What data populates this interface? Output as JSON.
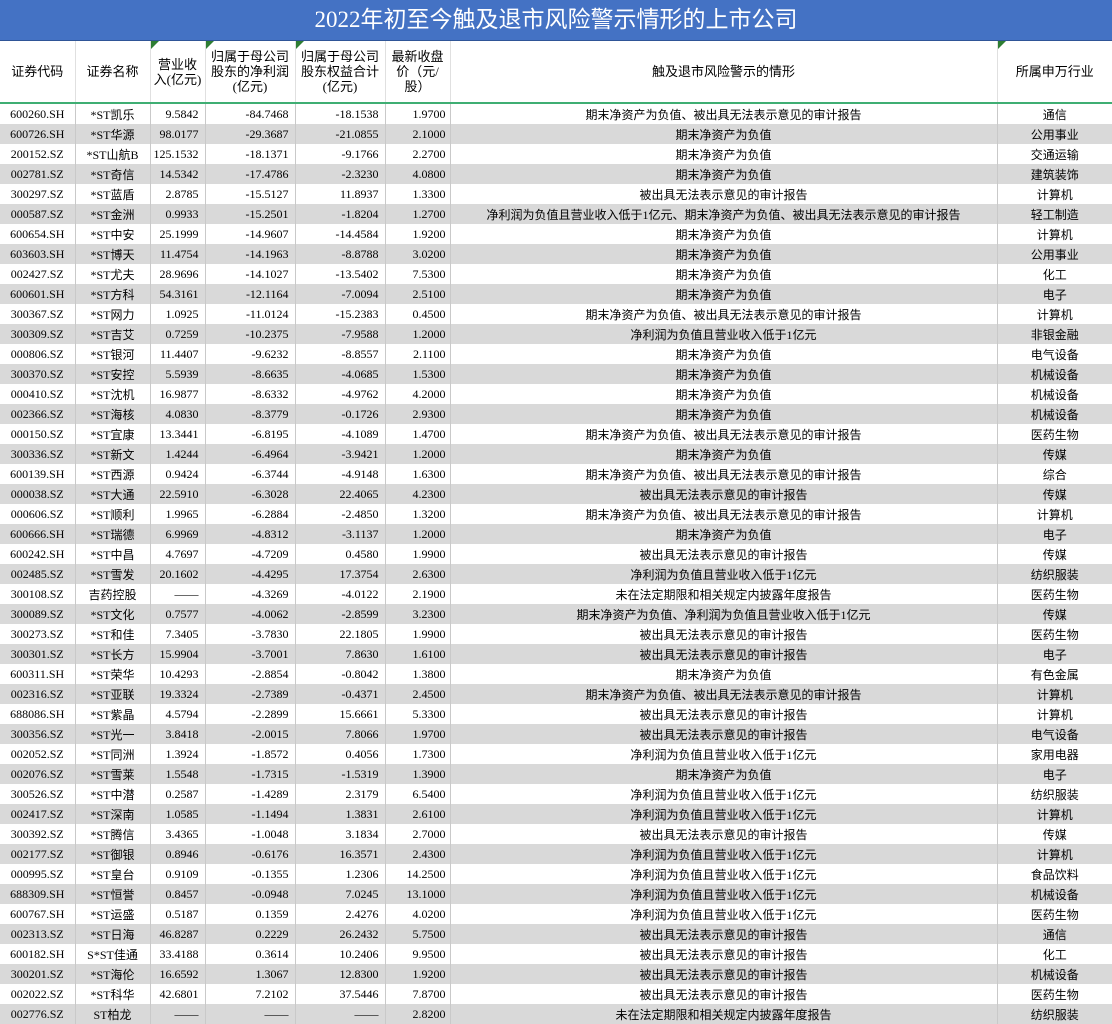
{
  "title": "2022年初至今触及退市风险警示情形的上市公司",
  "headers": {
    "code": "证券代码",
    "name": "证券名称",
    "revenue": "营业收入(亿元)",
    "net_profit": "归属于母公司股东的净利润(亿元)",
    "equity": "归属于母公司股东权益合计(亿元)",
    "close": "最新收盘价（元/股）",
    "situation": "触及退市风险警示的情形",
    "industry": "所属申万行业"
  },
  "rows": [
    [
      "600260.SH",
      "*ST凯乐",
      "9.5842",
      "-84.7468",
      "-18.1538",
      "1.9700",
      "期末净资产为负值、被出具无法表示意见的审计报告",
      "通信"
    ],
    [
      "600726.SH",
      "*ST华源",
      "98.0177",
      "-29.3687",
      "-21.0855",
      "2.1000",
      "期末净资产为负值",
      "公用事业"
    ],
    [
      "200152.SZ",
      "*ST山航B",
      "125.1532",
      "-18.1371",
      "-9.1766",
      "2.2700",
      "期末净资产为负值",
      "交通运输"
    ],
    [
      "002781.SZ",
      "*ST奇信",
      "14.5342",
      "-17.4786",
      "-2.3230",
      "4.0800",
      "期末净资产为负值",
      "建筑装饰"
    ],
    [
      "300297.SZ",
      "*ST蓝盾",
      "2.8785",
      "-15.5127",
      "11.8937",
      "1.3300",
      "被出具无法表示意见的审计报告",
      "计算机"
    ],
    [
      "000587.SZ",
      "*ST金洲",
      "0.9933",
      "-15.2501",
      "-1.8204",
      "1.2700",
      "净利润为负值且营业收入低于1亿元、期末净资产为负值、被出具无法表示意见的审计报告",
      "轻工制造"
    ],
    [
      "600654.SH",
      "*ST中安",
      "25.1999",
      "-14.9607",
      "-14.4584",
      "1.9200",
      "期末净资产为负值",
      "计算机"
    ],
    [
      "603603.SH",
      "*ST博天",
      "11.4754",
      "-14.1963",
      "-8.8788",
      "3.0200",
      "期末净资产为负值",
      "公用事业"
    ],
    [
      "002427.SZ",
      "*ST尤夫",
      "28.9696",
      "-14.1027",
      "-13.5402",
      "7.5300",
      "期末净资产为负值",
      "化工"
    ],
    [
      "600601.SH",
      "*ST方科",
      "54.3161",
      "-12.1164",
      "-7.0094",
      "2.5100",
      "期末净资产为负值",
      "电子"
    ],
    [
      "300367.SZ",
      "*ST网力",
      "1.0925",
      "-11.0124",
      "-15.2383",
      "0.4500",
      "期末净资产为负值、被出具无法表示意见的审计报告",
      "计算机"
    ],
    [
      "300309.SZ",
      "*ST吉艾",
      "0.7259",
      "-10.2375",
      "-7.9588",
      "1.2000",
      "净利润为负值且营业收入低于1亿元",
      "非银金融"
    ],
    [
      "000806.SZ",
      "*ST银河",
      "11.4407",
      "-9.6232",
      "-8.8557",
      "2.1100",
      "期末净资产为负值",
      "电气设备"
    ],
    [
      "300370.SZ",
      "*ST安控",
      "5.5939",
      "-8.6635",
      "-4.0685",
      "1.5300",
      "期末净资产为负值",
      "机械设备"
    ],
    [
      "000410.SZ",
      "*ST沈机",
      "16.9877",
      "-8.6332",
      "-4.9762",
      "4.2000",
      "期末净资产为负值",
      "机械设备"
    ],
    [
      "002366.SZ",
      "*ST海核",
      "4.0830",
      "-8.3779",
      "-0.1726",
      "2.9300",
      "期末净资产为负值",
      "机械设备"
    ],
    [
      "000150.SZ",
      "*ST宜康",
      "13.3441",
      "-6.8195",
      "-4.1089",
      "1.4700",
      "期末净资产为负值、被出具无法表示意见的审计报告",
      "医药生物"
    ],
    [
      "300336.SZ",
      "*ST新文",
      "1.4244",
      "-6.4964",
      "-3.9421",
      "1.2000",
      "期末净资产为负值",
      "传媒"
    ],
    [
      "600139.SH",
      "*ST西源",
      "0.9424",
      "-6.3744",
      "-4.9148",
      "1.6300",
      "期末净资产为负值、被出具无法表示意见的审计报告",
      "综合"
    ],
    [
      "000038.SZ",
      "*ST大通",
      "22.5910",
      "-6.3028",
      "22.4065",
      "4.2300",
      "被出具无法表示意见的审计报告",
      "传媒"
    ],
    [
      "000606.SZ",
      "*ST顺利",
      "1.9965",
      "-6.2884",
      "-2.4850",
      "1.3200",
      "期末净资产为负值、被出具无法表示意见的审计报告",
      "计算机"
    ],
    [
      "600666.SH",
      "*ST瑞德",
      "6.9969",
      "-4.8312",
      "-3.1137",
      "1.2000",
      "期末净资产为负值",
      "电子"
    ],
    [
      "600242.SH",
      "*ST中昌",
      "4.7697",
      "-4.7209",
      "0.4580",
      "1.9900",
      "被出具无法表示意见的审计报告",
      "传媒"
    ],
    [
      "002485.SZ",
      "*ST雪发",
      "20.1602",
      "-4.4295",
      "17.3754",
      "2.6300",
      "净利润为负值且营业收入低于1亿元",
      "纺织服装"
    ],
    [
      "300108.SZ",
      "吉药控股",
      "——",
      "-4.3269",
      "-4.0122",
      "2.1900",
      "未在法定期限和相关规定内披露年度报告",
      "医药生物"
    ],
    [
      "300089.SZ",
      "*ST文化",
      "0.7577",
      "-4.0062",
      "-2.8599",
      "3.2300",
      "期末净资产为负值、净利润为负值且营业收入低于1亿元",
      "传媒"
    ],
    [
      "300273.SZ",
      "*ST和佳",
      "7.3405",
      "-3.7830",
      "22.1805",
      "1.9900",
      "被出具无法表示意见的审计报告",
      "医药生物"
    ],
    [
      "300301.SZ",
      "*ST长方",
      "15.9904",
      "-3.7001",
      "7.8630",
      "1.6100",
      "被出具无法表示意见的审计报告",
      "电子"
    ],
    [
      "600311.SH",
      "*ST荣华",
      "10.4293",
      "-2.8854",
      "-0.8042",
      "1.3800",
      "期末净资产为负值",
      "有色金属"
    ],
    [
      "002316.SZ",
      "*ST亚联",
      "19.3324",
      "-2.7389",
      "-0.4371",
      "2.4500",
      "期末净资产为负值、被出具无法表示意见的审计报告",
      "计算机"
    ],
    [
      "688086.SH",
      "*ST紫晶",
      "4.5794",
      "-2.2899",
      "15.6661",
      "5.3300",
      "被出具无法表示意见的审计报告",
      "计算机"
    ],
    [
      "300356.SZ",
      "*ST光一",
      "3.8418",
      "-2.0015",
      "7.8066",
      "1.9700",
      "被出具无法表示意见的审计报告",
      "电气设备"
    ],
    [
      "002052.SZ",
      "*ST同洲",
      "1.3924",
      "-1.8572",
      "0.4056",
      "1.7300",
      "净利润为负值且营业收入低于1亿元",
      "家用电器"
    ],
    [
      "002076.SZ",
      "*ST雪莱",
      "1.5548",
      "-1.7315",
      "-1.5319",
      "1.3900",
      "期末净资产为负值",
      "电子"
    ],
    [
      "300526.SZ",
      "*ST中潜",
      "0.2587",
      "-1.4289",
      "2.3179",
      "6.5400",
      "净利润为负值且营业收入低于1亿元",
      "纺织服装"
    ],
    [
      "002417.SZ",
      "*ST深南",
      "1.0585",
      "-1.1494",
      "1.3831",
      "2.6100",
      "净利润为负值且营业收入低于1亿元",
      "计算机"
    ],
    [
      "300392.SZ",
      "*ST腾信",
      "3.4365",
      "-1.0048",
      "3.1834",
      "2.7000",
      "被出具无法表示意见的审计报告",
      "传媒"
    ],
    [
      "002177.SZ",
      "*ST御银",
      "0.8946",
      "-0.6176",
      "16.3571",
      "2.4300",
      "净利润为负值且营业收入低于1亿元",
      "计算机"
    ],
    [
      "000995.SZ",
      "*ST皇台",
      "0.9109",
      "-0.1355",
      "1.2306",
      "14.2500",
      "净利润为负值且营业收入低于1亿元",
      "食品饮料"
    ],
    [
      "688309.SH",
      "*ST恒誉",
      "0.8457",
      "-0.0948",
      "7.0245",
      "13.1000",
      "净利润为负值且营业收入低于1亿元",
      "机械设备"
    ],
    [
      "600767.SH",
      "*ST运盛",
      "0.5187",
      "0.1359",
      "2.4276",
      "4.0200",
      "净利润为负值且营业收入低于1亿元",
      "医药生物"
    ],
    [
      "002313.SZ",
      "*ST日海",
      "46.8287",
      "0.2229",
      "26.2432",
      "5.7500",
      "被出具无法表示意见的审计报告",
      "通信"
    ],
    [
      "600182.SH",
      "S*ST佳通",
      "33.4188",
      "0.3614",
      "10.2406",
      "9.9500",
      "被出具无法表示意见的审计报告",
      "化工"
    ],
    [
      "300201.SZ",
      "*ST海伦",
      "16.6592",
      "1.3067",
      "12.8300",
      "1.9200",
      "被出具无法表示意见的审计报告",
      "机械设备"
    ],
    [
      "002022.SZ",
      "*ST科华",
      "42.6801",
      "7.2102",
      "37.5446",
      "7.8700",
      "被出具无法表示意见的审计报告",
      "医药生物"
    ],
    [
      "002776.SZ",
      "ST柏龙",
      "——",
      "——",
      "——",
      "2.8200",
      "未在法定期限和相关规定内披露年度报告",
      "纺织服装"
    ]
  ]
}
